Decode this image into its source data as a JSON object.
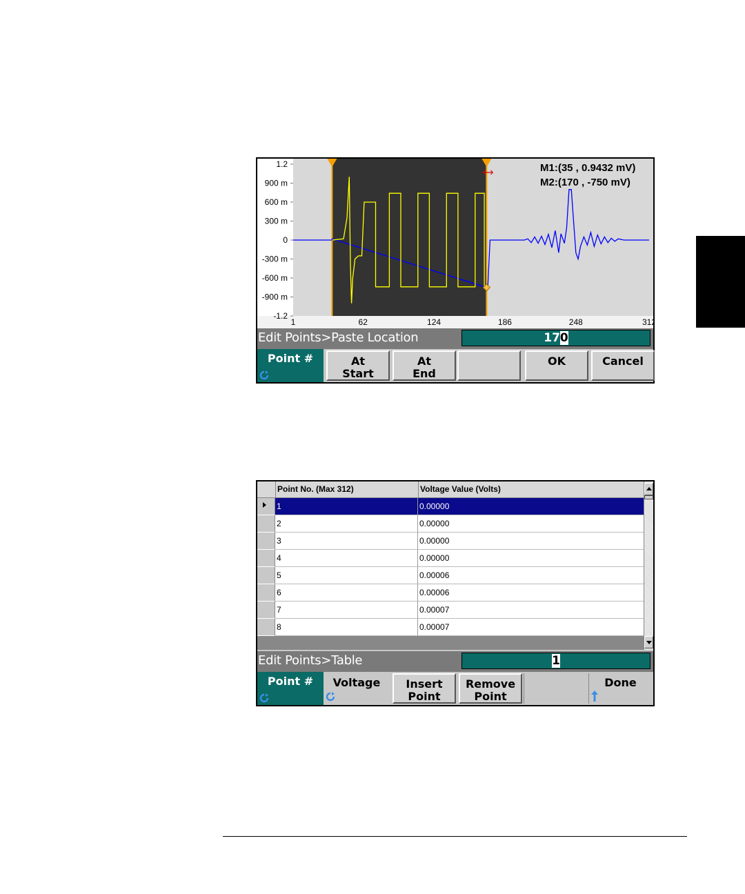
{
  "screen1": {
    "chart_data": {
      "type": "line",
      "y_tick_labels": [
        "1.2",
        "900 m",
        "600 m",
        "300 m",
        "0",
        "-300 m",
        "-600 m",
        "-900 m",
        "-1.2"
      ],
      "y_ticks": [
        1.2,
        0.9,
        0.6,
        0.3,
        0,
        -0.3,
        -0.6,
        -0.9,
        -1.2
      ],
      "x_tick_labels": [
        "1",
        "62",
        "124",
        "186",
        "248",
        "312"
      ],
      "x_ticks": [
        1,
        62,
        124,
        186,
        248,
        312
      ],
      "xlim": [
        1,
        312
      ],
      "ylim": [
        -1.2,
        1.2
      ],
      "selected_range": [
        35,
        170
      ],
      "series": [
        {
          "color": "#0000ff",
          "points": [
            [
              1,
              0
            ],
            [
              35,
              0
            ],
            [
              35,
              0.02
            ],
            [
              170,
              -0.75
            ],
            [
              171,
              -0.75
            ],
            [
              173,
              0
            ],
            [
              203,
              0
            ],
            [
              206,
              0.02
            ],
            [
              209,
              -0.04
            ],
            [
              212,
              0.05
            ],
            [
              215,
              -0.05
            ],
            [
              218,
              0.06
            ],
            [
              221,
              -0.07
            ],
            [
              224,
              0.09
            ],
            [
              227,
              -0.12
            ],
            [
              230,
              0.15
            ],
            [
              233,
              -0.2
            ],
            [
              235,
              0.1
            ],
            [
              238,
              -0.05
            ],
            [
              240,
              0.2
            ],
            [
              242,
              0.8
            ],
            [
              244,
              0.8
            ],
            [
              246,
              0.3
            ],
            [
              248,
              -0.2
            ],
            [
              250,
              -0.3
            ],
            [
              252,
              -0.1
            ],
            [
              255,
              0.05
            ],
            [
              258,
              -0.08
            ],
            [
              261,
              0.12
            ],
            [
              264,
              -0.1
            ],
            [
              267,
              0.08
            ],
            [
              270,
              -0.06
            ],
            [
              273,
              0.05
            ],
            [
              276,
              -0.04
            ],
            [
              279,
              0.03
            ],
            [
              282,
              -0.02
            ],
            [
              285,
              0.02
            ],
            [
              290,
              0
            ],
            [
              312,
              0
            ]
          ]
        },
        {
          "color": "#ffff00",
          "points": [
            [
              35,
              0
            ],
            [
              45,
              0.02
            ],
            [
              48,
              0.35
            ],
            [
              50,
              1.0
            ],
            [
              51,
              -0.4
            ],
            [
              52,
              -1.0
            ],
            [
              53,
              -0.6
            ],
            [
              55,
              -0.3
            ],
            [
              58,
              -0.25
            ],
            [
              61,
              -0.25
            ],
            [
              63,
              0.6
            ],
            [
              73,
              0.6
            ],
            [
              73,
              -0.74
            ],
            [
              85,
              -0.74
            ],
            [
              85,
              0.74
            ],
            [
              95,
              0.74
            ],
            [
              95,
              -0.74
            ],
            [
              110,
              -0.74
            ],
            [
              110,
              0.74
            ],
            [
              120,
              0.74
            ],
            [
              120,
              -0.74
            ],
            [
              135,
              -0.74
            ],
            [
              135,
              0.74
            ],
            [
              145,
              0.74
            ],
            [
              145,
              -0.74
            ],
            [
              160,
              -0.74
            ],
            [
              160,
              0.74
            ],
            [
              168,
              0.74
            ],
            [
              168,
              -0.74
            ],
            [
              170,
              -0.75
            ]
          ]
        }
      ],
      "markers": {
        "m1": "M1:(35 , 0.9432 mV)",
        "m2": "M2:(170  , -750 mV)"
      }
    },
    "status": {
      "label": "Edit Points>Paste Location",
      "value_prefix": "17",
      "value_cursor": "0"
    },
    "softkeys": [
      {
        "label1": "Point #",
        "label2": ""
      },
      {
        "label1": "At",
        "label2": "Start"
      },
      {
        "label1": "At",
        "label2": "End"
      },
      {
        "label1": "",
        "label2": ""
      },
      {
        "label1": "OK",
        "label2": ""
      },
      {
        "label1": "Cancel",
        "label2": ""
      }
    ]
  },
  "screen2": {
    "table": {
      "col1_header": "Point No. (Max 312)",
      "col2_header": "Voltage Value (Volts)",
      "rows": [
        {
          "point": "1",
          "voltage": "0.00000"
        },
        {
          "point": "2",
          "voltage": "0.00000"
        },
        {
          "point": "3",
          "voltage": "0.00000"
        },
        {
          "point": "4",
          "voltage": "0.00000"
        },
        {
          "point": "5",
          "voltage": "0.00006"
        },
        {
          "point": "6",
          "voltage": "0.00006"
        },
        {
          "point": "7",
          "voltage": "0.00007"
        },
        {
          "point": "8",
          "voltage": "0.00007"
        }
      ]
    },
    "status": {
      "label": "Edit Points>Table",
      "value_prefix": "",
      "value_cursor": "1"
    },
    "softkeys": [
      {
        "label1": "Point #",
        "label2": ""
      },
      {
        "label1": "Voltage",
        "label2": ""
      },
      {
        "label1": "Insert",
        "label2": "Point"
      },
      {
        "label1": "Remove",
        "label2": "Point"
      },
      {
        "label1": "",
        "label2": ""
      },
      {
        "label1": "Done",
        "label2": ""
      }
    ]
  },
  "icons": {
    "knob": "knob-icon",
    "up_arrow": "up-arrow-icon"
  },
  "colors": {
    "accent": "#0b6b66",
    "selection": "#0a0a8c",
    "marker": "#f5a000"
  }
}
